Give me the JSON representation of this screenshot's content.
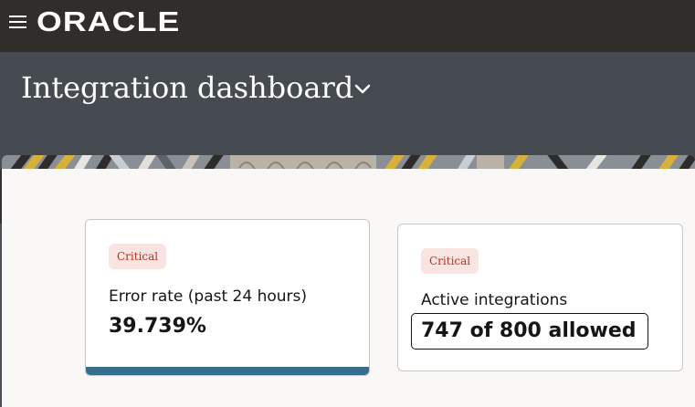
{
  "topbar": {
    "menu_icon": "hamburger-icon",
    "brand": "ORACLE"
  },
  "header": {
    "title": "Integration dashboard",
    "dropdown_icon": "chevron-down-icon"
  },
  "cards": [
    {
      "badge": "Critical",
      "label": "Error rate (past 24 hours)",
      "value": "39.739%",
      "bar_fill_fraction": 1.0,
      "bar_color": "#366d8b"
    },
    {
      "badge": "Critical",
      "label": "Active integrations",
      "value": "747 of 800 allowed"
    }
  ],
  "colors": {
    "topbar_bg": "#312d2a",
    "header_bg": "#464b51",
    "content_bg": "#faf8f6",
    "badge_bg": "#f9e4e1",
    "badge_text": "#b5321f"
  }
}
